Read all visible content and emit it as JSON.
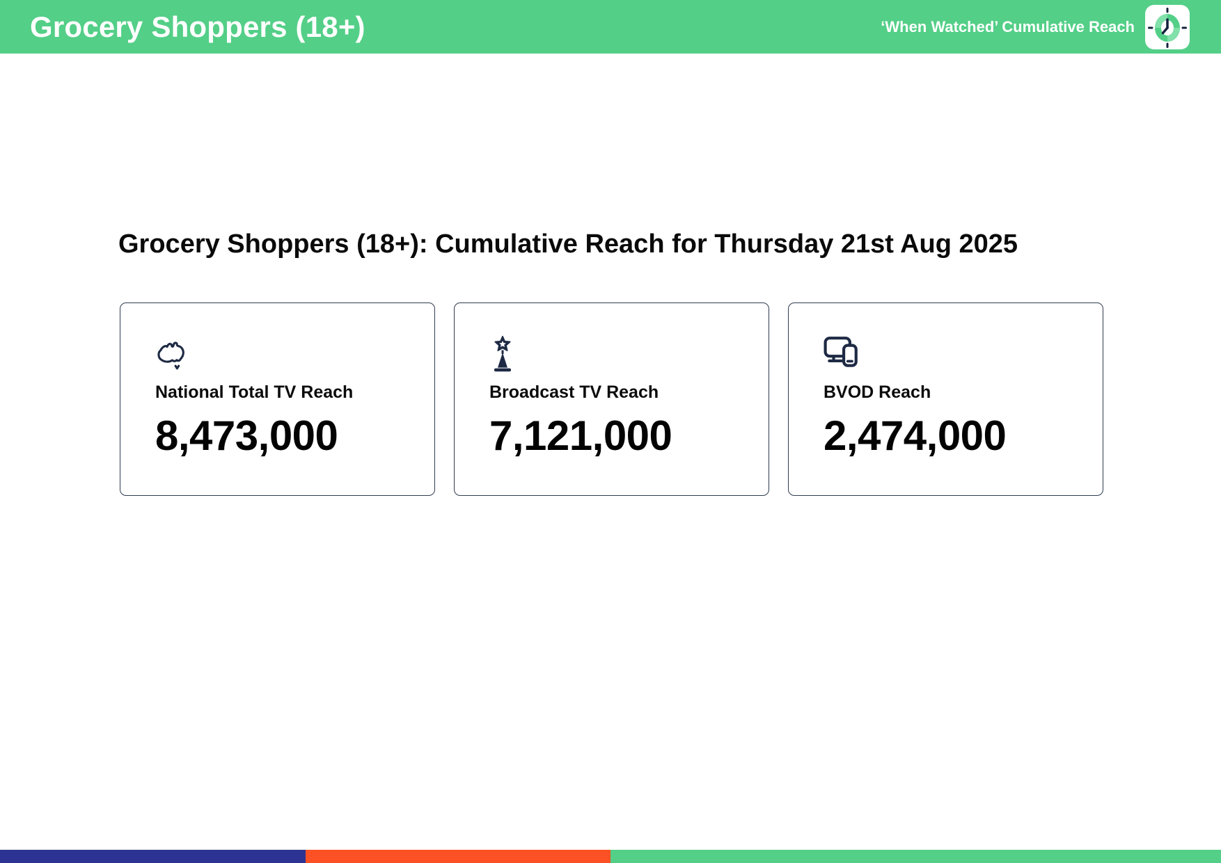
{
  "colors": {
    "brand_green": "#53CF87",
    "brand_green_light": "#82E0AA",
    "icon_navy": "#1E2A44",
    "card_border": "#2F3B4F",
    "footer_blue": "#2D3392",
    "footer_orange": "#FB5125",
    "footer_green": "#53CF87"
  },
  "header": {
    "title": "Grocery Shoppers (18+)",
    "subtitle": "‘When Watched’ Cumulative Reach",
    "logo_icon": "clock-logo-icon",
    "bg_css": "background:#53CF87"
  },
  "main": {
    "heading": "Grocery Shoppers (18+): Cumulative Reach for Thursday 21st Aug 2025",
    "cards": [
      {
        "icon": "australia-map-icon",
        "label": "National Total TV Reach",
        "value": "8,473,000"
      },
      {
        "icon": "broadcast-tower-icon",
        "label": "Broadcast TV Reach",
        "value": "7,121,000"
      },
      {
        "icon": "devices-icon",
        "label": "BVOD Reach",
        "value": "2,474,000"
      }
    ]
  },
  "footer": {
    "segments": [
      {
        "name": "blue",
        "css": "background:#2D3392"
      },
      {
        "name": "orange",
        "css": "background:#FB5125"
      },
      {
        "name": "green",
        "css": "background:#53CF87"
      }
    ]
  }
}
